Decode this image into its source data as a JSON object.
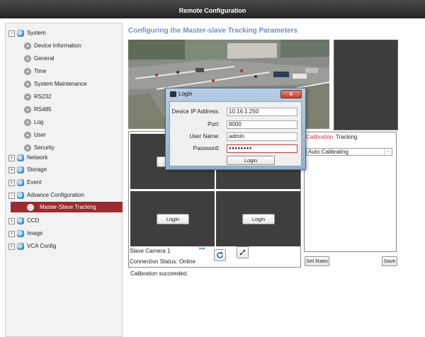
{
  "window": {
    "title": "Remote Configuration"
  },
  "sidebar": {
    "items": [
      {
        "label": "System",
        "expander": "−",
        "level": 0
      },
      {
        "label": "Device Information",
        "level": 1
      },
      {
        "label": "General",
        "level": 1
      },
      {
        "label": "Time",
        "level": 1
      },
      {
        "label": "System Maintenance",
        "level": 1
      },
      {
        "label": "RS232",
        "level": 1
      },
      {
        "label": "RS485",
        "level": 1
      },
      {
        "label": "Log",
        "level": 1
      },
      {
        "label": "User",
        "level": 1
      },
      {
        "label": "Security",
        "level": 1
      },
      {
        "label": "Network",
        "expander": "+",
        "level": 0
      },
      {
        "label": "Storage",
        "expander": "+",
        "level": 0
      },
      {
        "label": "Event",
        "expander": "+",
        "level": 0
      },
      {
        "label": "Advance Configuration",
        "expander": "−",
        "level": 0
      },
      {
        "label": "Master-Slave Tracking",
        "level": 1,
        "selected": true
      },
      {
        "label": "CCD",
        "expander": "+",
        "level": 0
      },
      {
        "label": "Image",
        "expander": "+",
        "level": 0
      },
      {
        "label": "VCA Config",
        "expander": "+",
        "level": 0
      }
    ],
    "selected_color": "#9b2b31"
  },
  "main": {
    "title": "Configuring the Master-slave Tracking Parameters",
    "title_color": "#6b93c9",
    "grid": {
      "login_label": "Login"
    },
    "slave_camera": "Slave Camera 1",
    "connection_status": "Connection Status: Online",
    "message": "Calibration succeeded."
  },
  "calibration": {
    "tabs": [
      "Calibration",
      "Tracking"
    ],
    "active_tab_color": "#d43a3a",
    "mode": "Auto Calibrating",
    "set_ratio_label": "Set Ratio",
    "save_label": "Save"
  },
  "login_dialog": {
    "title": "Login",
    "close_label": "x",
    "fields": {
      "ip_label": "Device IP Address:",
      "ip_value": "10.16.1.250",
      "port_label": "Port:",
      "port_value": "8000",
      "user_label": "User Name:",
      "user_value": "admin",
      "password_label": "Password:",
      "password_value": "●●●●●●●●"
    },
    "login_label": "Login"
  }
}
